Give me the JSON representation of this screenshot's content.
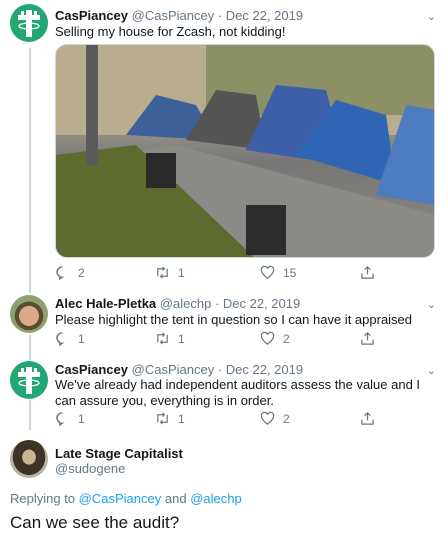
{
  "tweets": [
    {
      "name": "CasPiancey",
      "handle": "@CasPiancey",
      "date": "· Dec 22, 2019",
      "text": "Selling my house for Zcash, not kidding!",
      "replies": "2",
      "retweets": "1",
      "likes": "15"
    },
    {
      "name": "Alec Hale-Pletka",
      "handle": "@alechp",
      "date": "· Dec 22, 2019",
      "text": "Please highlight the tent in question so I can have it appraised",
      "replies": "1",
      "retweets": "1",
      "likes": "2"
    },
    {
      "name": "CasPiancey",
      "handle": "@CasPiancey",
      "date": "· Dec 22, 2019",
      "text": "We've already had independent auditors assess the value and I can assure you, everything is in order.",
      "replies": "1",
      "retweets": "1",
      "likes": "2"
    }
  ],
  "compose": {
    "name": "Late Stage Capitalist",
    "handle": "@sudogene",
    "replying_prefix": "Replying to",
    "replying_to_1": "@CasPiancey",
    "replying_and": "and",
    "replying_to_2": "@alechp",
    "text": "Can we see the audit?"
  },
  "colors": {
    "accent": "#1da1f2",
    "zcash": "#23a671"
  }
}
